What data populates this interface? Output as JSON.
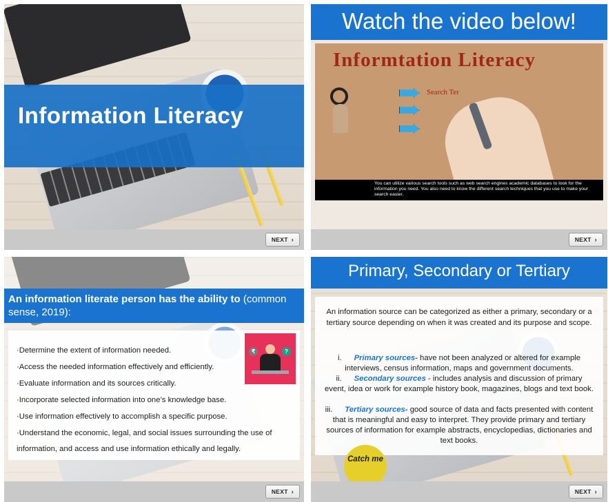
{
  "slides": [
    {
      "title": "Information Literacy",
      "next_label": "NEXT",
      "next_icon": "chevron-right-icon"
    },
    {
      "header": "Watch the video below!",
      "video": {
        "title": "Informtation Literacy",
        "search_term": "Search Ter",
        "caption": "You can utilize various search tools such as web search engines academic databases to look for the information you need. You also need to know the different search techniques that you use to make your search easier."
      },
      "next_label": "NEXT"
    },
    {
      "heading_bold": "An information literate person has the ability to",
      "heading_rest": " (common sense, 2019):",
      "bullets": [
        "·Determine the extent of information needed.",
        "·Access the needed information effectively and efficiently.",
        "·Evaluate information and its sources critically.",
        "·Incorporate selected information into one’s knowledge base.",
        "·Use information effectively to accomplish a specific purpose.",
        "·Understand the economic, legal, and social issues surrounding the use of",
        "information, and access and use information ethically and legally."
      ],
      "next_label": "NEXT"
    },
    {
      "title": "Primary, Secondary or Tertiary",
      "intro": "An information source can be categorized as either a primary, secondary or a tertiary source depending on when it was created and its purpose and scope.",
      "items": [
        {
          "num": "i.",
          "term": "Primary sources-",
          "text": " have not been analyzed or altered for example interviews, census information, maps and government documents."
        },
        {
          "num": "ii.",
          "term": "Secondary sources",
          "text": " - includes analysis and discussion of primary event, idea or work for example history book, magazines, blogs and text book."
        },
        {
          "num": "iii.",
          "term": "Tertiary sources-",
          "text": " good source of data and facts presented with content that is meaningful and easy to interpret. They provide primary and tertiary sources of information for example abstracts, encyclopedias, dictionaries and text books."
        }
      ],
      "catch_label": "Catch me",
      "next_label": "NEXT"
    }
  ],
  "colors": {
    "accent_blue": "#1a74cf",
    "video_title_red": "#a02718",
    "catch_yellow": "#e7cf2b",
    "badge_pink": "#e8315a"
  }
}
